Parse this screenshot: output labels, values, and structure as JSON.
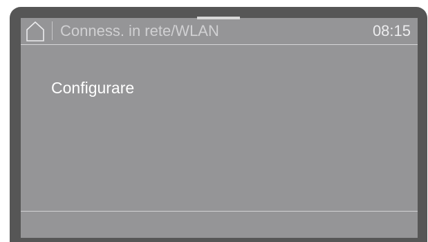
{
  "header": {
    "title": "Conness. in rete/WLAN",
    "clock": "08:15",
    "home_icon": "home-icon"
  },
  "menu": {
    "items": [
      {
        "label": "Configurare"
      }
    ]
  },
  "colors": {
    "bezel": "#565656",
    "screen": "#959597",
    "title_text": "#d0d0d2",
    "item_text": "#ffffff"
  }
}
